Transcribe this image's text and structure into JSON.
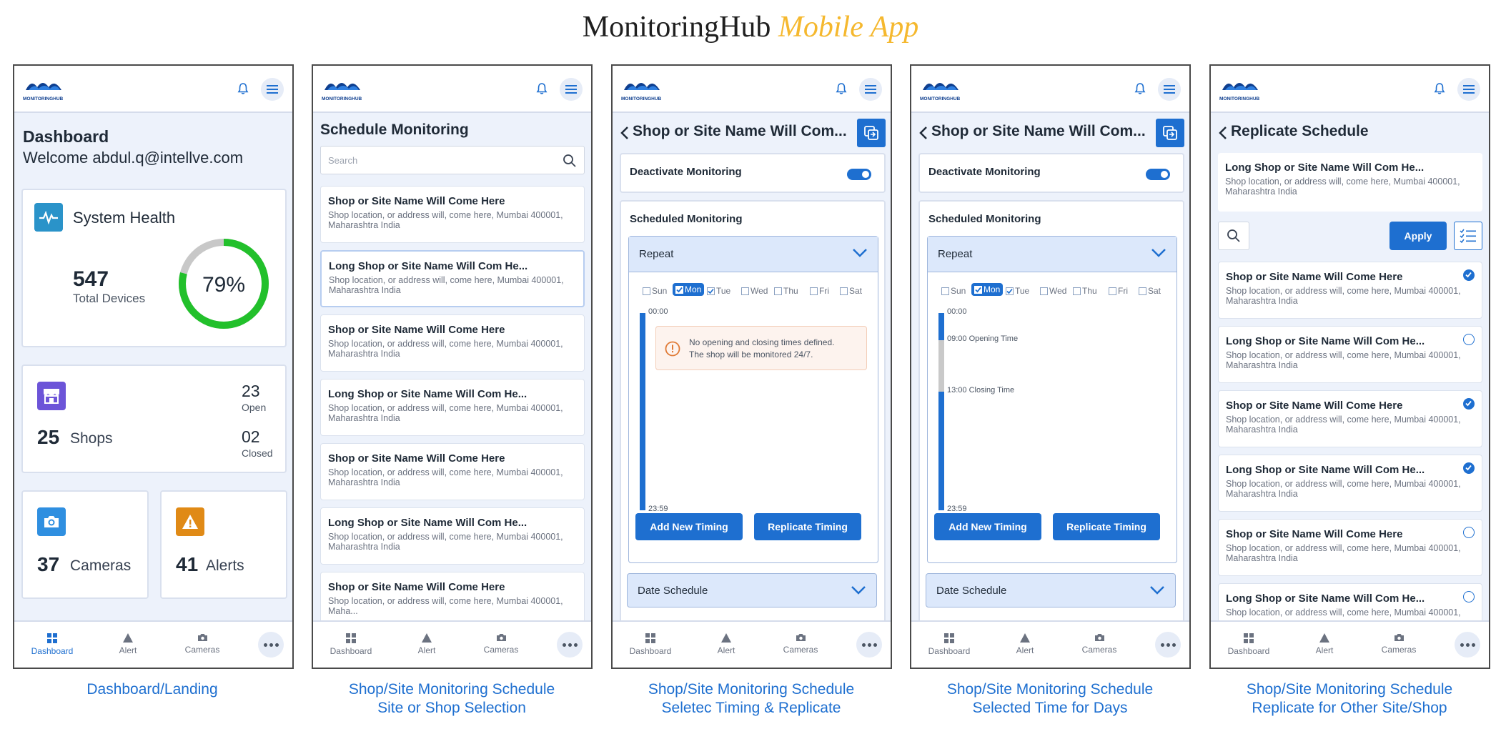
{
  "page": {
    "title_main": "MonitoringHub",
    "title_accent": "Mobile App"
  },
  "common": {
    "logo_alt": "MONITORINGHUB",
    "nav": {
      "dashboard": "Dashboard",
      "alert": "Alert",
      "cameras": "Cameras"
    },
    "search_placeholder": "Search"
  },
  "screens": [
    {
      "caption_line1": "Dashboard/Landing",
      "caption_line2": "",
      "title": "Dashboard",
      "welcome": "Welcome abdul.q@intellve.com",
      "system_health": {
        "label": "System Health",
        "total_devices_value": "547",
        "total_devices_label": "Total Devices",
        "percent_text": "79%",
        "percent": 0.79
      },
      "shops": {
        "value": "25",
        "label": "Shops",
        "open_value": "23",
        "open_label": "Open",
        "closed_value": "02",
        "closed_label": "Closed"
      },
      "cameras": {
        "value": "37",
        "label": "Cameras"
      },
      "alerts": {
        "value": "41",
        "label": "Alerts"
      }
    },
    {
      "caption_line1": "Shop/Site Monitoring Schedule",
      "caption_line2": "Site or Shop Selection",
      "title": "Schedule Monitoring",
      "items": [
        {
          "name": "Shop or Site Name Will Come Here",
          "address": "Shop location, or address will, come here, Mumbai 400001, Maharashtra India"
        },
        {
          "name": "Long Shop or Site Name Will Com He...",
          "address": "Shop location, or address will, come here, Mumbai 400001, Maharashtra India"
        },
        {
          "name": "Shop or Site Name Will Come Here",
          "address": "Shop location, or address will, come here, Mumbai 400001, Maharashtra India"
        },
        {
          "name": "Long Shop or Site Name Will Com He...",
          "address": "Shop location, or address will, come here, Mumbai 400001, Maharashtra India"
        },
        {
          "name": "Shop or Site Name Will Come Here",
          "address": "Shop location, or address will, come here, Mumbai 400001, Maharashtra India"
        },
        {
          "name": "Long Shop or Site Name Will Com He...",
          "address": "Shop location, or address will, come here, Mumbai 400001, Maharashtra India"
        },
        {
          "name": "Shop or Site Name Will Come Here",
          "address": "Shop location, or address will, come here, Mumbai 400001, Maha..."
        }
      ]
    },
    {
      "caption_line1": "Shop/Site Monitoring Schedule",
      "caption_line2": "Seletec Timing & Replicate",
      "title": "Shop or Site Name Will Com...",
      "deactivate_label": "Deactivate Monitoring",
      "scheduled_label": "Scheduled Monitoring",
      "repeat_label": "Repeat",
      "days": [
        "Sun",
        "Mon",
        "Tue",
        "Wed",
        "Thu",
        "Fri",
        "Sat"
      ],
      "time_start": "00:00",
      "time_end": "23:59",
      "notice_line1": "No opening and closing times defined.",
      "notice_line2": "The shop will be monitored 24/7.",
      "add_timing": "Add New Timing",
      "replicate_timing": "Replicate Timing",
      "date_schedule": "Date Schedule"
    },
    {
      "caption_line1": "Shop/Site Monitoring Schedule",
      "caption_line2": "Selected Time for Days",
      "title": "Shop or Site Name Will Com...",
      "deactivate_label": "Deactivate Monitoring",
      "scheduled_label": "Scheduled Monitoring",
      "repeat_label": "Repeat",
      "days": [
        "Sun",
        "Mon",
        "Tue",
        "Wed",
        "Thu",
        "Fri",
        "Sat"
      ],
      "time_start": "00:00",
      "time_end": "23:59",
      "opening": "09:00 Opening Time",
      "closing": "13:00 Closing Time",
      "add_timing": "Add New Timing",
      "replicate_timing": "Replicate Timing",
      "date_schedule": "Date Schedule"
    },
    {
      "caption_line1": "Shop/Site Monitoring Schedule",
      "caption_line2": "Replicate for Other Site/Shop",
      "title": "Replicate Schedule",
      "source": {
        "name": "Long Shop or Site Name Will Com He...",
        "address": "Shop location, or address will, come here, Mumbai 400001, Maharashtra India"
      },
      "apply_label": "Apply",
      "items": [
        {
          "name": "Shop or Site Name Will Come Here",
          "address": "Shop location, or address will, come here, Mumbai 400001, Maharashtra India",
          "checked": true
        },
        {
          "name": "Long Shop or Site Name Will Com He...",
          "address": "Shop location, or address will, come here, Mumbai 400001, Maharashtra India",
          "checked": false
        },
        {
          "name": "Shop or Site Name Will Come Here",
          "address": "Shop location, or address will, come here, Mumbai 400001, Maharashtra India",
          "checked": true
        },
        {
          "name": "Long Shop or Site Name Will Com He...",
          "address": "Shop location, or address will, come here, Mumbai 400001, Maharashtra India",
          "checked": true
        },
        {
          "name": "Shop or Site Name Will Come Here",
          "address": "Shop location, or address will, come here, Mumbai 400001, Maharashtra India",
          "checked": false
        },
        {
          "name": "Long Shop or Site Name Will Com He...",
          "address": "Shop location, or address will, come here, Mumbai 400001,",
          "checked": false
        }
      ]
    }
  ],
  "colors": {
    "primary": "#1e6fd0",
    "health_green": "#22c02b",
    "shops_purple": "#6c54d8",
    "camera_blue": "#2f8fe0",
    "alert_orange": "#e08a16",
    "title_accent": "#f5b82e"
  }
}
